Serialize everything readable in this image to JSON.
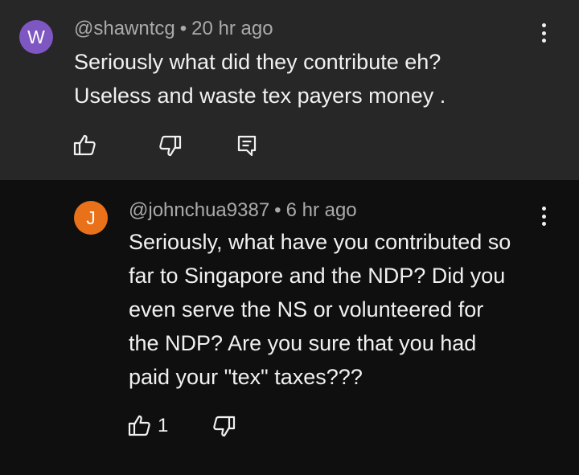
{
  "comments": [
    {
      "avatar_letter": "W",
      "avatar_color": "#7e57c2",
      "username": "@shawntcg",
      "separator": "•",
      "time": "20 hr ago",
      "text": "Seriously what did they contribute eh?\nUseless and waste tex payers money .",
      "icons": [
        "like-icon",
        "dislike-icon",
        "reply-icon",
        "more-icon"
      ]
    },
    {
      "avatar_letter": "J",
      "avatar_color": "#e8711a",
      "username": "@johnchua9387",
      "separator": "•",
      "time": "6 hr ago",
      "text": "Seriously, what have you contributed so\nfar to Singapore and the NDP? Did you\neven serve the NS or volunteered for\nthe NDP? Are you sure that you had\npaid your \"tex\" taxes???",
      "like_count": "1",
      "icons": [
        "like-icon",
        "dislike-icon",
        "more-icon"
      ]
    }
  ]
}
